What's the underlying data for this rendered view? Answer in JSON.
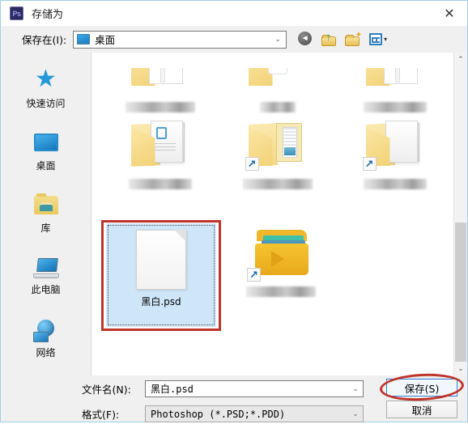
{
  "window": {
    "app_icon": "photoshop-icon",
    "app_icon_text": "Ps",
    "title": "存储为",
    "close_label": "✕"
  },
  "toolbar": {
    "save_in_label": "保存在(I):",
    "location_value": "桌面",
    "location_icon": "desktop-monitor-icon",
    "buttons": [
      {
        "name": "back-button",
        "icon": "back-arrow-icon",
        "glyph": "◄"
      },
      {
        "name": "up-folder-button",
        "icon": "up-folder-icon",
        "glyph": "↑"
      },
      {
        "name": "new-folder-button",
        "icon": "new-folder-icon",
        "glyph": "✦"
      },
      {
        "name": "view-mode-button",
        "icon": "view-grid-icon",
        "glyph": "▾"
      }
    ]
  },
  "places": [
    {
      "label": "快速访问",
      "icon": "star-icon"
    },
    {
      "label": "桌面",
      "icon": "desktop-icon"
    },
    {
      "label": "库",
      "icon": "library-folder-icon"
    },
    {
      "label": "此电脑",
      "icon": "this-pc-icon"
    },
    {
      "label": "网络",
      "icon": "network-globe-icon"
    }
  ],
  "file_list": {
    "rows": [
      {
        "items": [
          {
            "name": "folder-item",
            "icon": "folder-cut-icon",
            "label": "",
            "label_blurred": true,
            "shortcut": false
          },
          {
            "name": "folder-item",
            "icon": "cup-cut-icon",
            "label": "",
            "label_blurred": true,
            "shortcut": false
          },
          {
            "name": "folder-item",
            "icon": "folder-cut-icon",
            "label": "",
            "label_blurred": true,
            "shortcut": false
          }
        ]
      },
      {
        "items": [
          {
            "name": "folder-item",
            "icon": "documents-folder-icon",
            "label": "",
            "label_blurred": true,
            "shortcut": false
          },
          {
            "name": "folder-item",
            "icon": "pictures-folder-icon",
            "label": "",
            "label_blurred": true,
            "shortcut": true
          },
          {
            "name": "folder-item",
            "icon": "papers-folder-icon",
            "label": "",
            "label_blurred": true,
            "shortcut": true
          }
        ]
      },
      {
        "items": [
          {
            "name": "psd-file-item",
            "icon": "psd-document-icon",
            "label": "黑白.psd",
            "label_blurred": false,
            "selected": true,
            "highlighted": true
          },
          {
            "name": "folder-item",
            "icon": "media-folder-icon",
            "label": "",
            "label_blurred": true,
            "shortcut": true
          }
        ]
      }
    ],
    "scrollbar": {
      "up_glyph": "⌃",
      "down_glyph": "⌄"
    }
  },
  "form": {
    "filename_label": "文件名(N):",
    "filename_value": "黑白.psd",
    "format_label": "格式(F):",
    "format_value": "Photoshop (*.PSD;*.PDD)",
    "save_button": "保存(S)",
    "cancel_button": "取消",
    "caret_glyph": "⌄"
  },
  "annotations": {
    "highlight_color": "#c0342a",
    "selection_color": "#cfe6f9",
    "accent_color": "#2a7bd4",
    "ellipse_target": "save-button",
    "box_target": "psd-file-item"
  }
}
